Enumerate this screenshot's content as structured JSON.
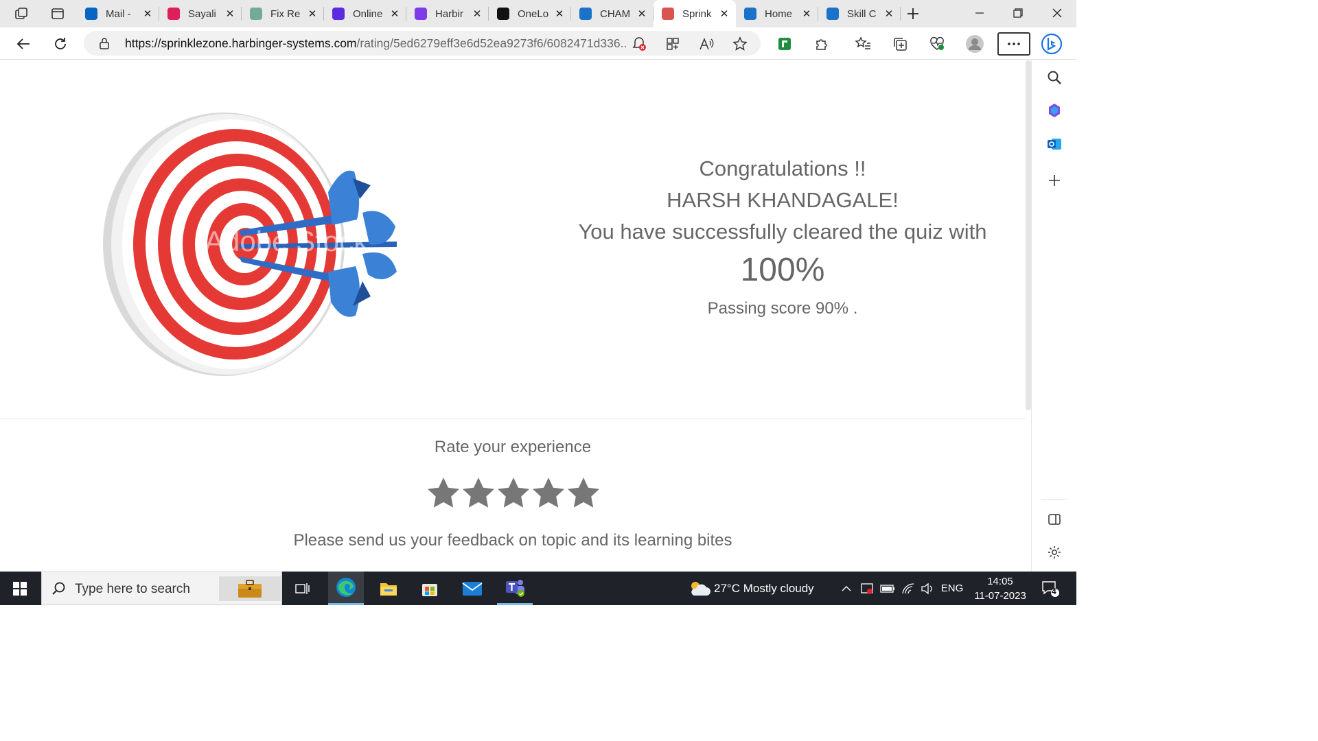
{
  "browser": {
    "tabs": [
      {
        "title": "Mail -",
        "favicon": "outlook-icon",
        "color": "#0a64c4"
      },
      {
        "title": "Sayali",
        "favicon": "slack-icon",
        "color": "#e01e5a"
      },
      {
        "title": "Fix Re",
        "favicon": "chatgpt-icon",
        "color": "#74aa9c"
      },
      {
        "title": "Online",
        "favicon": "p-logo-icon",
        "color": "#5b2be0"
      },
      {
        "title": "Harbir",
        "favicon": "harbinger-icon",
        "color": "#7d3ce8"
      },
      {
        "title": "OneLo",
        "favicon": "onelogin-icon",
        "color": "#111111"
      },
      {
        "title": "CHAM",
        "favicon": "page-icon",
        "color": "#1a73c8"
      },
      {
        "title": "Sprink",
        "favicon": "sprinkle-icon",
        "color": "#d9534f",
        "active": true
      },
      {
        "title": "Home",
        "favicon": "page-icon",
        "color": "#1a73c8"
      },
      {
        "title": "Skill C",
        "favicon": "page-icon",
        "color": "#1a73c8"
      }
    ],
    "url_host": "https://sprinklezone.harbinger-systems.com",
    "url_path": "/rating/5ed6279eff3e6d52ea9273f6/6082471d336..."
  },
  "result": {
    "congrats": "Congratulations !!",
    "user_name": "HARSH KHANDAGALE!",
    "cleared_text": "You have successfully cleared the quiz with",
    "score": "100%",
    "passing": "Passing score 90% ."
  },
  "rating": {
    "label": "Rate your experience",
    "stars_total": 5,
    "stars_filled": 0,
    "star_color": "#777777",
    "feedback": "Please send us your feedback on topic and its learning bites"
  },
  "taskbar": {
    "search_placeholder": "Type here to search",
    "weather": "27°C  Mostly cloudy",
    "language": "ENG",
    "time": "14:05",
    "date": "11-07-2023",
    "notifications": "4"
  },
  "image": {
    "watermark": "Adobe Stock"
  }
}
